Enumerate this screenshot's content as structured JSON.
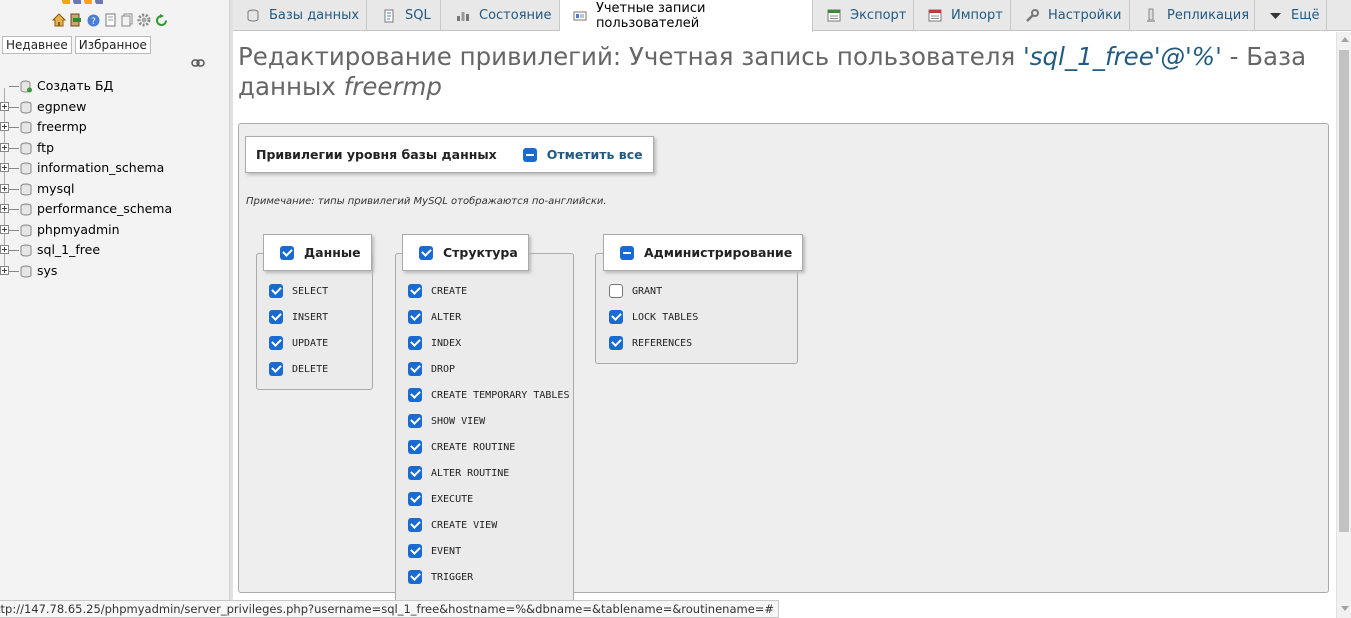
{
  "window": {
    "status_url": "ttp://147.78.65.25/phpmyadmin/server_privileges.php?username=sql_1_free&hostname=%&dbname=&tablename=&routinename=#"
  },
  "nav": {
    "toolbar_icons": [
      "home-icon",
      "logout-icon",
      "help-icon",
      "docs-icon",
      "copy-icon",
      "settings-icon",
      "reload-icon"
    ],
    "tabs": [
      "Недавнее",
      "Избранное"
    ],
    "tree": [
      {
        "label": "Создать БД",
        "expandable": false
      },
      {
        "label": "egpnew",
        "expandable": true
      },
      {
        "label": "freermp",
        "expandable": true
      },
      {
        "label": "ftp",
        "expandable": true
      },
      {
        "label": "information_schema",
        "expandable": true
      },
      {
        "label": "mysql",
        "expandable": true
      },
      {
        "label": "performance_schema",
        "expandable": true
      },
      {
        "label": "phpmyadmin",
        "expandable": true
      },
      {
        "label": "sql_1_free",
        "expandable": true
      },
      {
        "label": "sys",
        "expandable": true
      }
    ]
  },
  "menubar": {
    "tabs": [
      {
        "label": "Базы данных",
        "icon": "database-icon"
      },
      {
        "label": "SQL",
        "icon": "sql-icon"
      },
      {
        "label": "Состояние",
        "icon": "status-icon"
      },
      {
        "label": "Учетные записи пользователей",
        "icon": "users-icon",
        "active": true
      },
      {
        "label": "Экспорт",
        "icon": "export-icon"
      },
      {
        "label": "Импорт",
        "icon": "import-icon"
      },
      {
        "label": "Настройки",
        "icon": "wrench-icon"
      },
      {
        "label": "Репликация",
        "icon": "replication-icon"
      },
      {
        "label": "Ещё",
        "icon": "chevron-down-icon"
      }
    ]
  },
  "main": {
    "title_prefix": "Редактирование привилегий: Учетная запись пользователя ",
    "title_account": "'sql_1_free'@'%'",
    "title_middle": " - База данных ",
    "title_db": "freermp",
    "fieldset_legend": "Привилегии уровня базы данных",
    "check_all_label": "Отметить все",
    "note": "Примечание: типы привилегий MySQL отображаются по-английски.",
    "groups": {
      "data": {
        "label": "Данные",
        "state": "checked",
        "privileges": [
          {
            "name": "SELECT",
            "checked": true
          },
          {
            "name": "INSERT",
            "checked": true
          },
          {
            "name": "UPDATE",
            "checked": true
          },
          {
            "name": "DELETE",
            "checked": true
          }
        ]
      },
      "structure": {
        "label": "Структура",
        "state": "checked",
        "privileges": [
          {
            "name": "CREATE",
            "checked": true
          },
          {
            "name": "ALTER",
            "checked": true
          },
          {
            "name": "INDEX",
            "checked": true
          },
          {
            "name": "DROP",
            "checked": true
          },
          {
            "name": "CREATE TEMPORARY TABLES",
            "checked": true
          },
          {
            "name": "SHOW VIEW",
            "checked": true
          },
          {
            "name": "CREATE ROUTINE",
            "checked": true
          },
          {
            "name": "ALTER ROUTINE",
            "checked": true
          },
          {
            "name": "EXECUTE",
            "checked": true
          },
          {
            "name": "CREATE VIEW",
            "checked": true
          },
          {
            "name": "EVENT",
            "checked": true
          },
          {
            "name": "TRIGGER",
            "checked": true
          }
        ]
      },
      "admin": {
        "label": "Администрирование",
        "state": "mixed",
        "privileges": [
          {
            "name": "GRANT",
            "checked": false
          },
          {
            "name": "LOCK TABLES",
            "checked": true
          },
          {
            "name": "REFERENCES",
            "checked": true
          }
        ]
      }
    }
  },
  "colors": {
    "accent": "#235a81",
    "checkbox": "#1a6bd1"
  }
}
